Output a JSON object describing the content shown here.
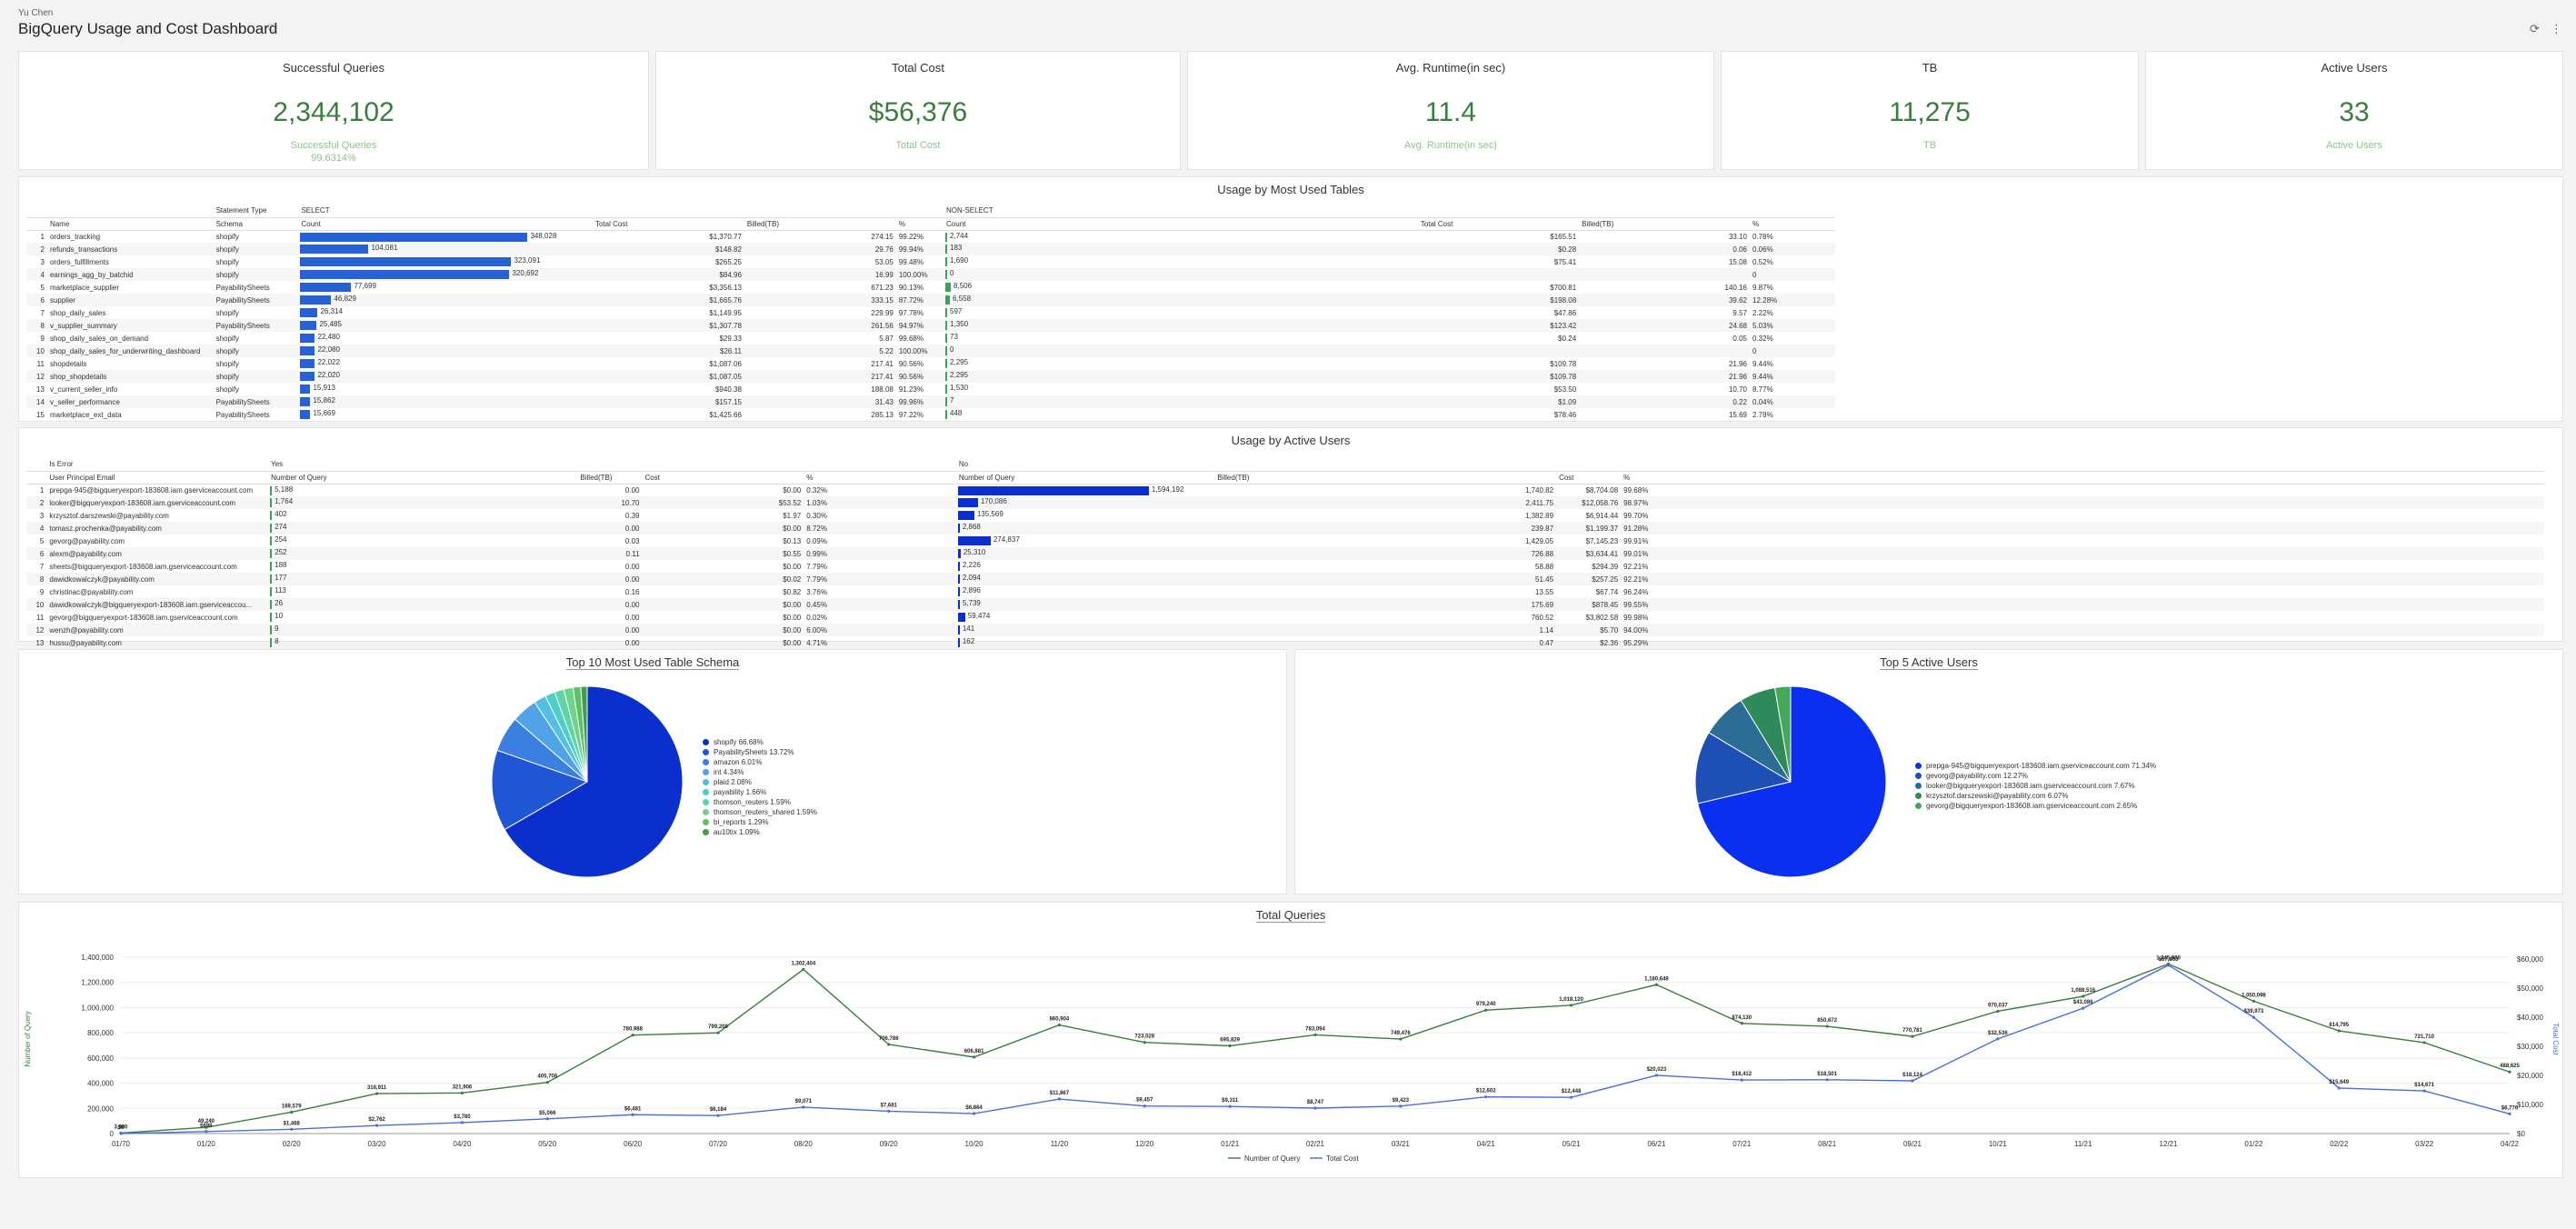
{
  "header": {
    "owner": "Yu Chen",
    "title": "BigQuery Usage and Cost Dashboard"
  },
  "kpis": [
    {
      "title": "Successful Queries",
      "value": "2,344,102",
      "sub": "Successful Queries",
      "sub2": "99.6314%"
    },
    {
      "title": "Total Cost",
      "value": "$56,376",
      "sub": "Total Cost",
      "sub2": ""
    },
    {
      "title": "Avg. Runtime(in sec)",
      "value": "11.4",
      "sub": "Avg. Runtime(in sec)",
      "sub2": ""
    },
    {
      "title": "TB",
      "value": "11,275",
      "sub": "TB",
      "sub2": ""
    },
    {
      "title": "Active Users",
      "value": "33",
      "sub": "Active Users",
      "sub2": ""
    }
  ],
  "tables_panel": {
    "title": "Usage by Most Used Tables",
    "pivot_label": "Statement Type",
    "groups": [
      "SELECT",
      "NON-SELECT"
    ],
    "cols": [
      "Name",
      "Schema",
      "Count",
      "Total Cost",
      "Billed(TB)",
      "%",
      "Count",
      "Total Cost",
      "Billed(TB)",
      "%"
    ],
    "rows": [
      [
        "1",
        "orders_tracking",
        "shopify",
        "348,028",
        "$1,370.77",
        "274.15",
        "99.22%",
        "2,744",
        "$165.51",
        "33.10",
        "0.78%"
      ],
      [
        "2",
        "refunds_transactions",
        "shopify",
        "104,081",
        "$148.82",
        "29.76",
        "99.94%",
        "183",
        "$0.28",
        "0.06",
        "0.06%"
      ],
      [
        "3",
        "orders_fulfillments",
        "shopify",
        "323,091",
        "$265.25",
        "53.05",
        "99.48%",
        "1,690",
        "$75.41",
        "15.08",
        "0.52%"
      ],
      [
        "4",
        "earnings_agg_by_batchid",
        "shopify",
        "320,692",
        "$84.96",
        "16.99",
        "100.00%",
        "0",
        "",
        "",
        "0"
      ],
      [
        "5",
        "marketplace_supplier",
        "PayabilitySheets",
        "77,699",
        "$3,356.13",
        "671.23",
        "90.13%",
        "8,506",
        "$700.81",
        "140.16",
        "9.87%"
      ],
      [
        "6",
        "supplier",
        "PayabilitySheets",
        "46,829",
        "$1,665.76",
        "333.15",
        "87.72%",
        "6,558",
        "$198.08",
        "39.62",
        "12.28%"
      ],
      [
        "7",
        "shop_daily_sales",
        "shopify",
        "26,314",
        "$1,149.95",
        "229.99",
        "97.78%",
        "597",
        "$47.86",
        "9.57",
        "2.22%"
      ],
      [
        "8",
        "v_supplier_summary",
        "PayabilitySheets",
        "25,485",
        "$1,307.78",
        "261.56",
        "94.97%",
        "1,350",
        "$123.42",
        "24.68",
        "5.03%"
      ],
      [
        "9",
        "shop_daily_sales_on_demand",
        "shopify",
        "22,480",
        "$29.33",
        "5.87",
        "99.68%",
        "73",
        "$0.24",
        "0.05",
        "0.32%"
      ],
      [
        "10",
        "shop_daily_sales_for_underwriting_dashboard",
        "shopify",
        "22,080",
        "$26.11",
        "5.22",
        "100.00%",
        "0",
        "",
        "",
        "0"
      ],
      [
        "11",
        "shopdetails",
        "shopify",
        "22,022",
        "$1,087.06",
        "217.41",
        "90.56%",
        "2,295",
        "$109.78",
        "21.96",
        "9.44%"
      ],
      [
        "12",
        "shop_shopdetails",
        "shopify",
        "22,020",
        "$1,087.05",
        "217.41",
        "90.56%",
        "2,295",
        "$109.78",
        "21.96",
        "9.44%"
      ],
      [
        "13",
        "v_current_seller_info",
        "shopify",
        "15,913",
        "$940.38",
        "188.08",
        "91.23%",
        "1,530",
        "$53.50",
        "10.70",
        "8.77%"
      ],
      [
        "14",
        "v_seller_performance",
        "PayabilitySheets",
        "15,862",
        "$157.15",
        "31.43",
        "99.96%",
        "7",
        "$1.09",
        "0.22",
        "0.04%"
      ],
      [
        "15",
        "marketplace_ext_data",
        "PayabilitySheets",
        "15,669",
        "$1,425.66",
        "285.13",
        "97.22%",
        "448",
        "$78.46",
        "15.69",
        "2.78%"
      ]
    ]
  },
  "users_panel": {
    "title": "Usage by Active Users",
    "pivot_label": "Is Error",
    "groups": [
      "Yes",
      "No"
    ],
    "cols": [
      "User Principal Email",
      "Number of Query",
      "Billed(TB)",
      "Cost",
      "%",
      "Number of Query",
      "Billed(TB)",
      "Cost",
      "%"
    ],
    "rows": [
      [
        "1",
        "prepga-945@bigqueryexport-183608.iam.gserviceaccount.com",
        "5,188",
        "0.00",
        "$0.00",
        "0.32%",
        "1,594,192",
        "1,740.82",
        "$8,704.08",
        "99.68%"
      ],
      [
        "2",
        "looker@bigqueryexport-183608.iam.gserviceaccount.com",
        "1,764",
        "10.70",
        "$53.52",
        "1.03%",
        "170,086",
        "2,411.75",
        "$12,058.76",
        "98.97%"
      ],
      [
        "3",
        "krzysztof.darszewski@payability.com",
        "402",
        "0.39",
        "$1.97",
        "0.30%",
        "135,569",
        "1,382.89",
        "$6,914.44",
        "99.70%"
      ],
      [
        "4",
        "tomasz.prochenka@payability.com",
        "274",
        "0.00",
        "$0.00",
        "8.72%",
        "2,868",
        "239.87",
        "$1,199.37",
        "91.28%"
      ],
      [
        "5",
        "gevorg@payability.com",
        "254",
        "0.03",
        "$0.13",
        "0.09%",
        "274,837",
        "1,429.05",
        "$7,145.23",
        "99.91%"
      ],
      [
        "6",
        "alexm@payability.com",
        "252",
        "0.11",
        "$0.55",
        "0.99%",
        "25,310",
        "726.88",
        "$3,634.41",
        "99.01%"
      ],
      [
        "7",
        "sheets@bigqueryexport-183608.iam.gserviceaccount.com",
        "188",
        "0.00",
        "$0.00",
        "7.79%",
        "2,226",
        "58.88",
        "$294.39",
        "92.21%"
      ],
      [
        "8",
        "dawidkowalczyk@payability.com",
        "177",
        "0.00",
        "$0.02",
        "7.79%",
        "2,094",
        "51.45",
        "$257.25",
        "92.21%"
      ],
      [
        "9",
        "christinac@payability.com",
        "113",
        "0.16",
        "$0.82",
        "3.76%",
        "2,896",
        "13.55",
        "$67.74",
        "96.24%"
      ],
      [
        "10",
        "dawidkowalczyk@bigqueryexport-183608.iam.gserviceaccou...",
        "26",
        "0.00",
        "$0.00",
        "0.45%",
        "5,739",
        "175.69",
        "$878.45",
        "99.55%"
      ],
      [
        "11",
        "gevorg@bigqueryexport-183608.iam.gserviceaccount.com",
        "10",
        "0.00",
        "$0.00",
        "0.02%",
        "59,474",
        "760.52",
        "$3,802.58",
        "99.98%"
      ],
      [
        "12",
        "wenzh@payability.com",
        "9",
        "0.00",
        "$0.00",
        "6.00%",
        "141",
        "1.14",
        "$5.70",
        "94.00%"
      ],
      [
        "13",
        "hussu@payability.com",
        "8",
        "0.00",
        "$0.00",
        "4.71%",
        "162",
        "0.47",
        "$2.36",
        "95.29%"
      ]
    ]
  },
  "pie_schema": {
    "title": "Top 10 Most Used Table Schema",
    "slices": [
      {
        "label": "shopify 66.68%",
        "value": 66.68,
        "color": "#0b2fcc"
      },
      {
        "label": "PayabilitySheets 13.72%",
        "value": 13.72,
        "color": "#1f56d6"
      },
      {
        "label": "amazon 6.01%",
        "value": 6.01,
        "color": "#3b7fe0"
      },
      {
        "label": "int 4.34%",
        "value": 4.34,
        "color": "#4fa3e6"
      },
      {
        "label": "plaid 2.08%",
        "value": 2.08,
        "color": "#55bfe3"
      },
      {
        "label": "payability 1.66%",
        "value": 1.66,
        "color": "#4dcfc5"
      },
      {
        "label": "thomson_reuters 1.59%",
        "value": 1.59,
        "color": "#5cd6a6"
      },
      {
        "label": "thomson_reuters_shared 1.59%",
        "value": 1.59,
        "color": "#6fd38c"
      },
      {
        "label": "bi_reports 1.29%",
        "value": 1.29,
        "color": "#5cbf6a"
      },
      {
        "label": "au10tix 1.09%",
        "value": 1.09,
        "color": "#3f9d4f"
      }
    ]
  },
  "pie_users": {
    "title": "Top 5  Active Users",
    "slices": [
      {
        "label": "prepga-945@bigqueryexport-183608.iam.gserviceaccount.com 71.34%",
        "value": 71.34,
        "color": "#0a2ff0"
      },
      {
        "label": "gevorg@payability.com 12.27%",
        "value": 12.27,
        "color": "#1e4fb5"
      },
      {
        "label": "looker@bigqueryexport-183608.iam.gserviceaccount.com 7.67%",
        "value": 7.67,
        "color": "#2c6d96"
      },
      {
        "label": "krzysztof.darszewski@payability.com 6.07%",
        "value": 6.07,
        "color": "#2e8a5b"
      },
      {
        "label": "gevorg@bigqueryexport-183608.iam.gserviceaccount.com 2.65%",
        "value": 2.65,
        "color": "#44a858"
      }
    ]
  },
  "chart_data": {
    "type": "line",
    "title": "Total Queries",
    "xlabel": "",
    "ylabel": "Number of Query",
    "y2label": "Total Cost",
    "categories": [
      "01/70",
      "01/20",
      "02/20",
      "03/20",
      "04/20",
      "05/20",
      "06/20",
      "07/20",
      "08/20",
      "09/20",
      "10/20",
      "11/20",
      "12/20",
      "01/21",
      "02/21",
      "03/21",
      "04/21",
      "05/21",
      "06/21",
      "07/21",
      "08/21",
      "09/21",
      "10/21",
      "11/21",
      "12/21",
      "01/22",
      "02/22",
      "03/22",
      "04/22"
    ],
    "yticks": [
      "0",
      "200,000",
      "400,000",
      "600,000",
      "800,000",
      "1,000,000",
      "1,200,000",
      "1,400,000"
    ],
    "y2ticks": [
      "$0",
      "$10,000",
      "$20,000",
      "$30,000",
      "$40,000",
      "$50,000",
      "$60,000"
    ],
    "ylim": [
      0,
      1500000
    ],
    "y2lim": [
      0,
      65000
    ],
    "series": [
      {
        "name": "Number of Query",
        "color": "#3b7d3f",
        "values": [
          3900,
          49240,
          169579,
          316911,
          321906,
          405706,
          780988,
          799208,
          1302404,
          706786,
          606881,
          860904,
          723028,
          695829,
          783094,
          749476,
          979240,
          1018120,
          1180649,
          874130,
          850672,
          770781,
          970037,
          1088516,
          1345900,
          1050098,
          814795,
          721710,
          488625
        ],
        "labels": [
          "3,900",
          "49,240",
          "169,579",
          "316,911",
          "321,906",
          "405,706",
          "780,988",
          "799,208",
          "1,302,404",
          "706,786",
          "606,881",
          "860,904",
          "723,028",
          "695,829",
          "783,094",
          "749,476",
          "979,240",
          "1,018,120",
          "1,180,649",
          "874,130",
          "850,672",
          "770,781",
          "970,037",
          "1,088,516",
          "1,345,900",
          "1,050,098",
          "814,795",
          "721,710",
          "488,625"
        ]
      },
      {
        "name": "Total Cost",
        "color": "#4a6fd6",
        "values": [
          0,
          698,
          1468,
          2762,
          3780,
          5066,
          6481,
          6184,
          9071,
          7681,
          6864,
          11867,
          9457,
          9311,
          8747,
          9423,
          12602,
          12448,
          20023,
          18412,
          18501,
          18124,
          32536,
          43086,
          57863,
          39973,
          15649,
          14671,
          6776
        ],
        "labels": [
          "$0",
          "$698",
          "$1,468",
          "$2,762",
          "$3,780",
          "$5,066",
          "$6,481",
          "$6,184",
          "$9,071",
          "$7,681",
          "$6,864",
          "$11,867",
          "$9,457",
          "$9,311",
          "$8,747",
          "$9,423",
          "$12,602",
          "$12,448",
          "$20,023",
          "$18,412",
          "$18,501",
          "$18,124",
          "$32,536",
          "$43,086",
          "$57,863",
          "$39,973",
          "$15,649",
          "$14,671",
          "$6,776"
        ]
      }
    ],
    "legend": "bottom"
  }
}
